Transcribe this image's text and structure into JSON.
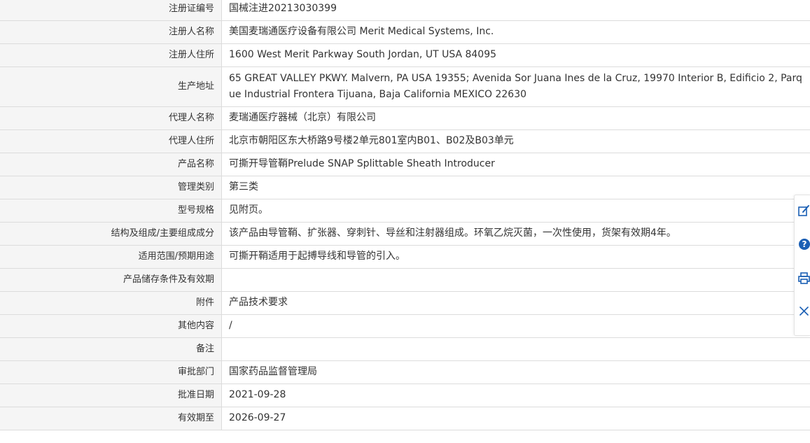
{
  "rows": [
    {
      "label": "注册证编号",
      "value": "国械注进20213030399"
    },
    {
      "label": "注册人名称",
      "value": "美国麦瑞通医疗设备有限公司 Merit Medical Systems, Inc."
    },
    {
      "label": "注册人住所",
      "value": "1600 West Merit Parkway South Jordan, UT USA 84095"
    },
    {
      "label": "生产地址",
      "value": "65 GREAT VALLEY PKWY. Malvern, PA USA 19355; Avenida Sor Juana Ines de la Cruz, 19970 Interior B, Edificio 2, Parque Industrial Frontera Tijuana, Baja California MEXICO 22630"
    },
    {
      "label": "代理人名称",
      "value": "麦瑞通医疗器械（北京）有限公司"
    },
    {
      "label": "代理人住所",
      "value": "北京市朝阳区东大桥路9号楼2单元801室内B01、B02及B03单元"
    },
    {
      "label": "产品名称",
      "value": "可撕开导管鞘Prelude SNAP Splittable Sheath Introducer"
    },
    {
      "label": "管理类别",
      "value": "第三类"
    },
    {
      "label": "型号规格",
      "value": "见附页。"
    },
    {
      "label": "结构及组成/主要组成成分",
      "value": "该产品由导管鞘、扩张器、穿刺针、导丝和注射器组成。环氧乙烷灭菌，一次性使用，货架有效期4年。"
    },
    {
      "label": "适用范围/预期用途",
      "value": "可撕开鞘适用于起搏导线和导管的引入。"
    },
    {
      "label": "产品储存条件及有效期",
      "value": ""
    },
    {
      "label": "附件",
      "value": "产品技术要求"
    },
    {
      "label": "其他内容",
      "value": "/"
    },
    {
      "label": "备注",
      "value": ""
    },
    {
      "label": "审批部门",
      "value": "国家药品监督管理局"
    },
    {
      "label": "批准日期",
      "value": "2021-09-28"
    },
    {
      "label": "有效期至",
      "value": "2026-09-27"
    }
  ],
  "side_toolbar": {
    "icons": [
      "edit-icon",
      "help-icon",
      "print-icon",
      "close-icon"
    ],
    "accent_color": "#1a5fb4"
  }
}
